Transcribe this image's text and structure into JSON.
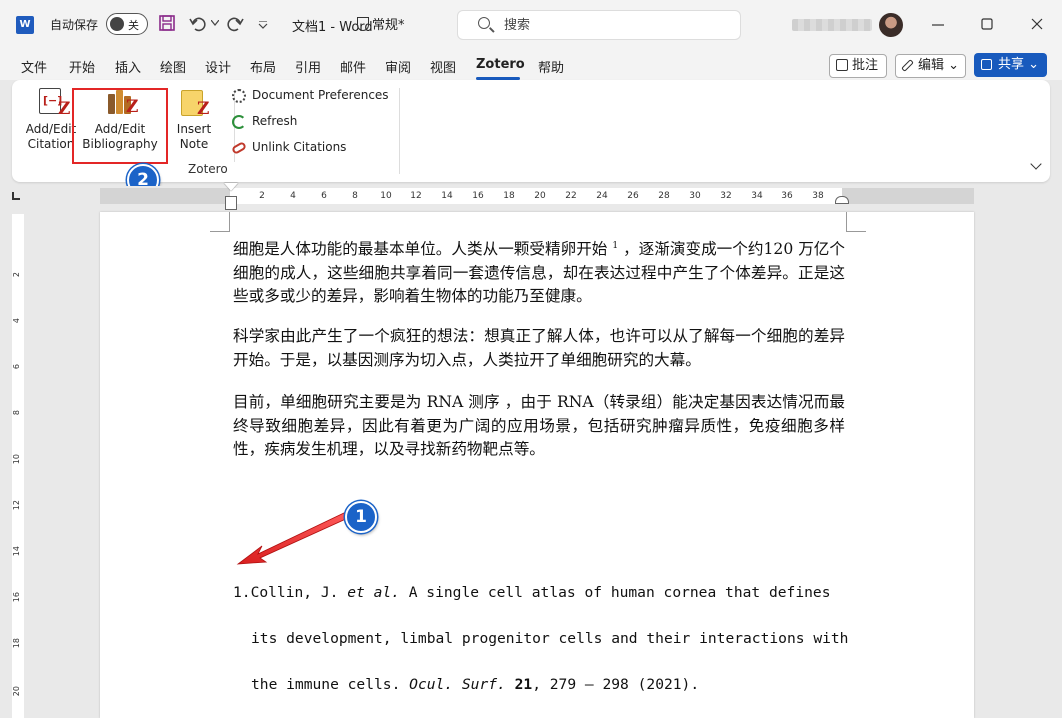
{
  "titlebar": {
    "app_icon": "word-logo-icon",
    "app_icon_letter": "W",
    "autosave_label": "自动保存",
    "autosave_state": "关",
    "doc_title": "文档1  -  Word",
    "sensitivity": "常规*",
    "search_placeholder": "搜索"
  },
  "menu": {
    "items": [
      "文件",
      "开始",
      "插入",
      "绘图",
      "设计",
      "布局",
      "引用",
      "邮件",
      "审阅",
      "视图",
      "Zotero",
      "帮助"
    ],
    "active": "Zotero",
    "comments": "批注",
    "editing": "编辑",
    "editing_caret": "⌄",
    "share": "共享",
    "share_caret": "⌄"
  },
  "ribbon": {
    "add_edit_citation": [
      "Add/Edit",
      "Citation"
    ],
    "add_edit_bibliography": [
      "Add/Edit",
      "Bibliography"
    ],
    "insert_note": [
      "Insert",
      "Note"
    ],
    "document_preferences": "Document Preferences",
    "refresh": "Refresh",
    "unlink_citations": "Unlink Citations",
    "group_label": "Zotero",
    "zotero_letter": "Z"
  },
  "annotations": {
    "badge_1": "1",
    "badge_2": "2",
    "highlight_color": "#e32626",
    "badge_color": "#1b63c8"
  },
  "ruler": {
    "h_ticks": [
      "2",
      "4",
      "6",
      "8",
      "10",
      "12",
      "14",
      "16",
      "18",
      "20",
      "22",
      "24",
      "26",
      "28",
      "30",
      "32",
      "34",
      "36",
      "38"
    ],
    "v_ticks": [
      "2",
      "4",
      "6",
      "8",
      "10",
      "12",
      "14",
      "16",
      "18",
      "20"
    ]
  },
  "document": {
    "p1_before_sup": "细胞是人体功能的最基本单位。人类从一颗受精卵开始 ",
    "p1_sup": "1",
    "p1_after_sup": " ，逐渐演变成一个约120 万亿个细胞的成人，这些细胞共享着同一套遗传信息，却在表达过程中产生了个体差异。正是这些或多或少的差异，影响着生物体的功能乃至健康。",
    "p2": "科学家由此产生了一个疯狂的想法：想真正了解人体，也许可以从了解每一个细胞的差异开始。于是，以基因测序为切入点，人类拉开了单细胞研究的大幕。",
    "p3": "目前，单细胞研究主要是为 RNA 测序 ，由于 RNA（转录组）能决定基因表达情况而最终导致细胞差异，因此有着更为广阔的应用场景，包括研究肿瘤异质性，免疫细胞多样性，疾病发生机理，以及寻找新药物靶点等。",
    "ref_num": "1.",
    "ref_l1_a": "Collin, J. ",
    "ref_l1_i": "et al.",
    "ref_l1_b": " A single cell atlas of human cornea that defines",
    "ref_l2": "its development, limbal progenitor cells and their interactions with",
    "ref_l3_i": "Ocul. Surf.",
    "ref_l3_vol": "21",
    "ref_l3_a": "the immune cells. ",
    "ref_l3_c": ", 279 – 298 (2021)."
  }
}
